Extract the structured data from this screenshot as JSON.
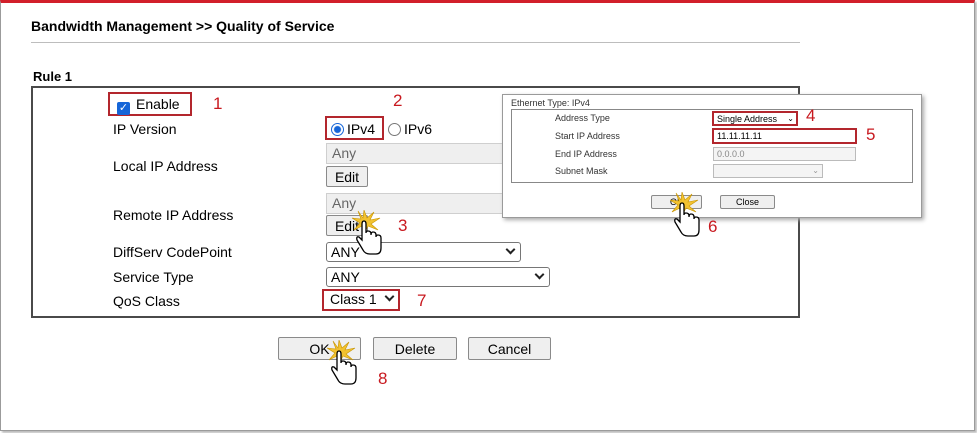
{
  "header": {
    "title": "Bandwidth Management >> Quality of Service"
  },
  "rule": {
    "title": "Rule 1",
    "enable_label": "Enable",
    "ip_version_label": "IP Version",
    "ipv4_label": "IPv4",
    "ipv6_label": "IPv6",
    "local_ip_label": "Local IP Address",
    "local_ip_value": "Any",
    "remote_ip_label": "Remote IP Address",
    "remote_ip_value": "Any",
    "edit_label": "Edit",
    "diffserv_label": "DiffServ CodePoint",
    "diffserv_value": "ANY",
    "service_type_label": "Service Type",
    "service_type_value": "ANY",
    "qos_class_label": "QoS Class",
    "qos_class_value": "Class 1"
  },
  "buttons": {
    "ok": "OK",
    "delete": "Delete",
    "cancel": "Cancel"
  },
  "popup": {
    "title": "Ethernet Type: IPv4",
    "address_type_label": "Address Type",
    "address_type_value": "Single Address",
    "start_ip_label": "Start IP Address",
    "start_ip_value": "11.11.11.11",
    "end_ip_label": "End IP Address",
    "end_ip_value": "0.0.0.0",
    "subnet_mask_label": "Subnet Mask",
    "subnet_mask_value": "",
    "ok_label": "OK",
    "close_label": "Close"
  },
  "steps": [
    "1",
    "2",
    "3",
    "4",
    "5",
    "6",
    "7",
    "8"
  ],
  "colors": {
    "accent_border": "#d21f2a",
    "highlight": "#b3262d",
    "step_number": "#c8191f",
    "radio_checked": "#1565d8"
  },
  "icons": {
    "cursor": "pointing-hand-click-icon"
  }
}
